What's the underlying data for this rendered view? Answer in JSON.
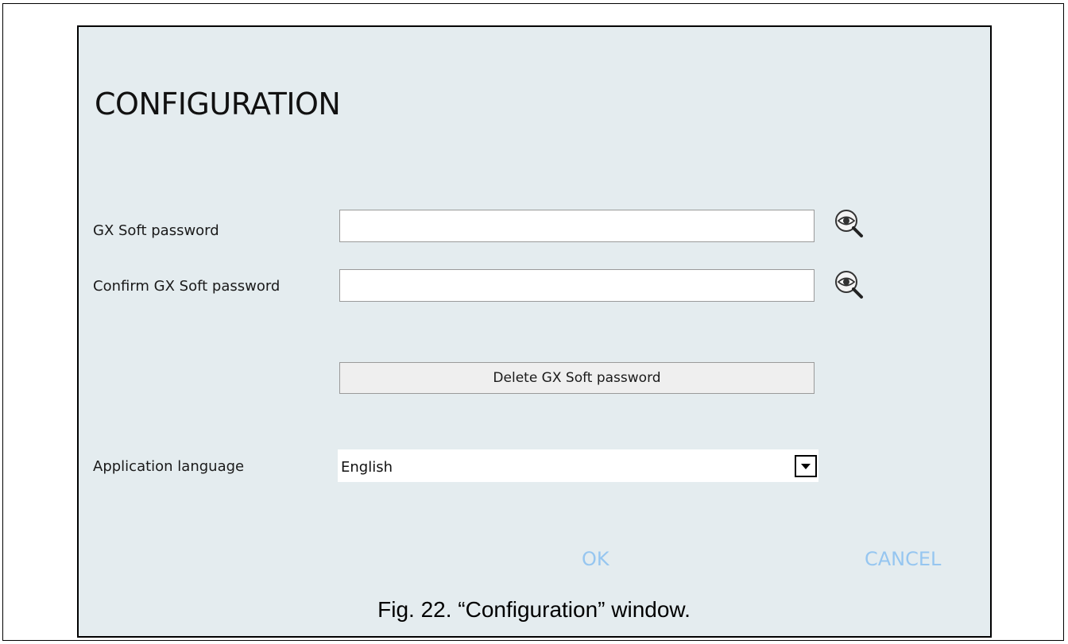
{
  "window": {
    "title": "CONFIGURATION",
    "fields": [
      {
        "label": "GX Soft password",
        "value": "",
        "reveal_icon": "eye-magnifier-icon"
      },
      {
        "label": "Confirm GX Soft password",
        "value": "",
        "reveal_icon": "eye-magnifier-icon"
      }
    ],
    "delete_button_label": "Delete GX Soft password",
    "language": {
      "label": "Application language",
      "selected": "English"
    },
    "ok_label": "OK",
    "cancel_label": "CANCEL",
    "colors": {
      "background": "#e4ecef",
      "action_text": "#96c6f0"
    }
  },
  "caption": "Fig. 22. “Configuration” window."
}
